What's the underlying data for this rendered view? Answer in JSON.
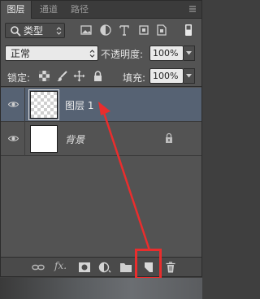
{
  "tabs": [
    {
      "label": "图层",
      "active": true
    },
    {
      "label": "通道",
      "active": false
    },
    {
      "label": "路径",
      "active": false
    }
  ],
  "filter": {
    "kind_label": "类型",
    "icons": [
      "image-filter-icon",
      "adjustment-filter-icon",
      "type-filter-icon",
      "shape-filter-icon",
      "smart-object-filter-icon",
      "filter-toggle-icon"
    ]
  },
  "blend": {
    "mode": "正常",
    "opacity_label": "不透明度:",
    "opacity_value": "100%"
  },
  "lock": {
    "label": "锁定:",
    "icons": [
      "lock-transparent-icon",
      "lock-image-icon",
      "lock-position-icon",
      "lock-all-icon"
    ],
    "fill_label": "填充:",
    "fill_value": "100%"
  },
  "layers": [
    {
      "name": "图层 1",
      "selected": true,
      "thumbnail": "transparent",
      "locked": false
    },
    {
      "name": "背景",
      "selected": false,
      "thumbnail": "white",
      "locked": true
    }
  ],
  "footer": {
    "fx_label": "fx.",
    "icons": [
      "link-layers-icon",
      "add-style-icon",
      "add-mask-icon",
      "adjustment-layer-icon",
      "new-group-icon",
      "new-layer-icon",
      "delete-layer-icon"
    ]
  },
  "colors": {
    "panel": "#535353",
    "selected_row": "#566273",
    "annotation": "#ea2d2d"
  }
}
